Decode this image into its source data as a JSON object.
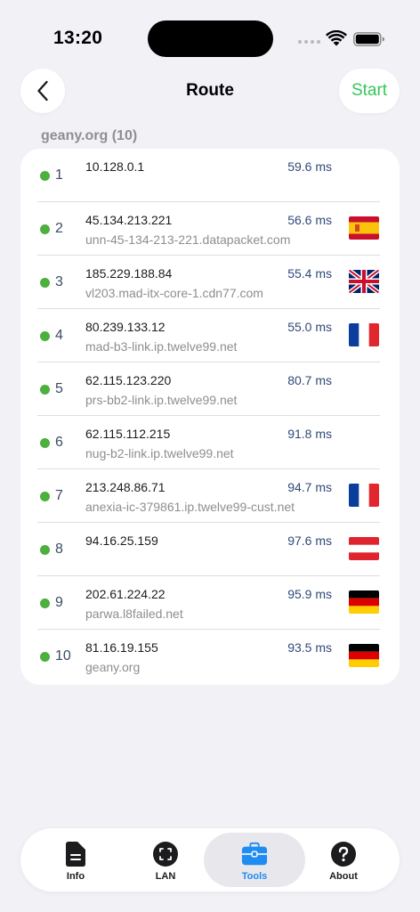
{
  "status": {
    "time": "13:20"
  },
  "nav": {
    "title": "Route",
    "start_label": "Start"
  },
  "section": {
    "header": "geany.org (10)"
  },
  "hops": [
    {
      "num": "1",
      "ip": "10.128.0.1",
      "host": "",
      "ms": "59.6 ms",
      "flag": ""
    },
    {
      "num": "2",
      "ip": "45.134.213.221",
      "host": "unn-45-134-213-221.datapacket.com",
      "ms": "56.6 ms",
      "flag": "spain-flag"
    },
    {
      "num": "3",
      "ip": "185.229.188.84",
      "host": "vl203.mad-itx-core-1.cdn77.com",
      "ms": "55.4 ms",
      "flag": "uk-flag"
    },
    {
      "num": "4",
      "ip": "80.239.133.12",
      "host": "mad-b3-link.ip.twelve99.net",
      "ms": "55.0 ms",
      "flag": "france-flag"
    },
    {
      "num": "5",
      "ip": "62.115.123.220",
      "host": "prs-bb2-link.ip.twelve99.net",
      "ms": "80.7 ms",
      "flag": ""
    },
    {
      "num": "6",
      "ip": "62.115.112.215",
      "host": "nug-b2-link.ip.twelve99.net",
      "ms": "91.8 ms",
      "flag": ""
    },
    {
      "num": "7",
      "ip": "213.248.86.71",
      "host": "anexia-ic-379861.ip.twelve99-cust.net",
      "ms": "94.7 ms",
      "flag": "france-flag"
    },
    {
      "num": "8",
      "ip": "94.16.25.159",
      "host": "",
      "ms": "97.6 ms",
      "flag": "austria-flag"
    },
    {
      "num": "9",
      "ip": "202.61.224.22",
      "host": "parwa.l8failed.net",
      "ms": "95.9 ms",
      "flag": "germany-flag"
    },
    {
      "num": "10",
      "ip": "81.16.19.155",
      "host": "geany.org",
      "ms": "93.5 ms",
      "flag": "germany-flag"
    }
  ],
  "tabs": [
    {
      "label": "Info",
      "icon": "document-icon"
    },
    {
      "label": "LAN",
      "icon": "lan-icon"
    },
    {
      "label": "Tools",
      "icon": "toolbox-icon"
    },
    {
      "label": "About",
      "icon": "question-icon"
    }
  ],
  "colors": {
    "accent": "#1e8cf2",
    "start": "#34c759",
    "status_dot": "#4caf3e"
  }
}
